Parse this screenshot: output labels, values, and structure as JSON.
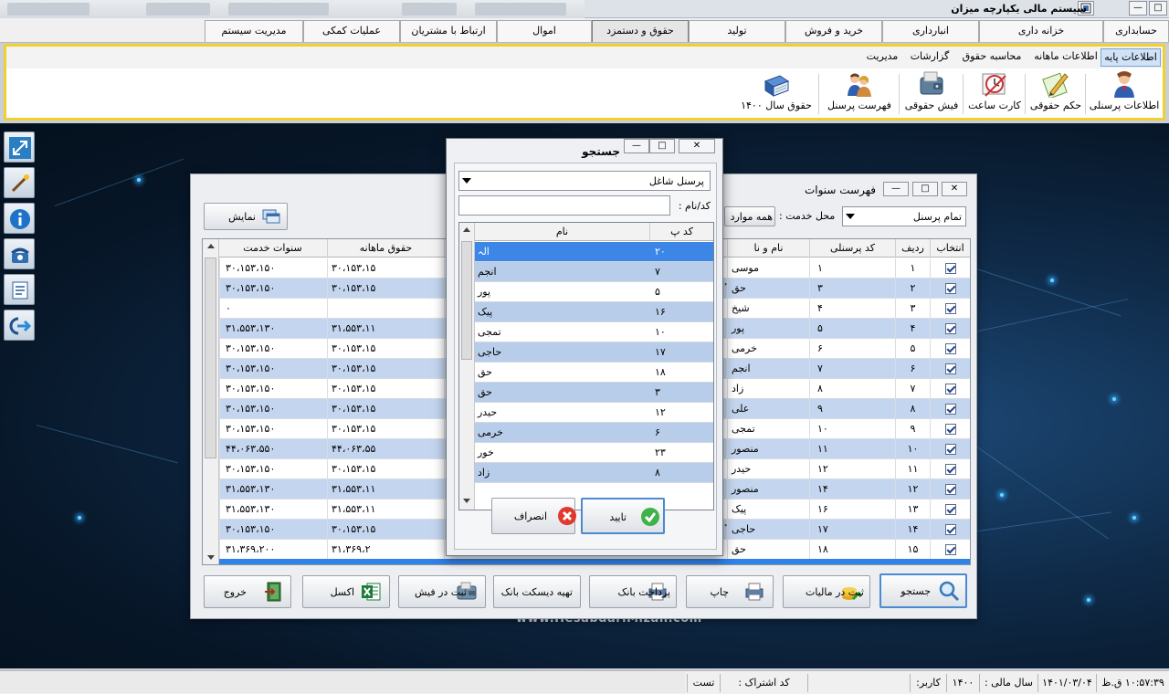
{
  "app": {
    "title": "سیستم مالی یکپارچه میزان",
    "window_buttons": [
      "□",
      "—"
    ]
  },
  "menu": {
    "tabs": [
      "حسابداری",
      "خزانه داری",
      "انبارداری",
      "خرید و فروش",
      "تولید",
      "حقوق و دستمزد",
      "اموال",
      "ارتباط با مشتریان",
      "عملیات کمکی",
      "مدیریت سیستم"
    ],
    "active_index": 5
  },
  "ribbon": {
    "tabs": [
      "اطلاعات پایه",
      "اطلاعات ماهانه",
      "محاسبه حقوق",
      "گزارشات",
      "مدیریت"
    ],
    "active_index": 0,
    "buttons": [
      {
        "label": "اطلاعات پرسنلی",
        "icon": "personnel-icon"
      },
      {
        "label": "حکم حقوقی",
        "icon": "decree-icon"
      },
      {
        "label": "کارت ساعت",
        "icon": "timecard-icon"
      },
      {
        "label": "فیش حقوقی",
        "icon": "payslip-icon"
      },
      {
        "label": "فهرست پرسنل",
        "icon": "staff-list-icon"
      },
      {
        "label": "حقوق سال ۱۴۰۰",
        "icon": "salary-year-icon"
      }
    ]
  },
  "side_toolbar": [
    "resize-icon",
    "magic-wand-icon",
    "info-icon",
    "phone-icon",
    "notes-icon",
    "exit-icon"
  ],
  "watermark": "www.HesabdariMizan.com",
  "main_window": {
    "title": "فهرست سنوات",
    "filters": {
      "personnel_select": "تمام پرسنل",
      "location_label": "محل خدمت :",
      "location_value": "همه موارد",
      "show_button": "نمایش"
    },
    "columns": [
      "انتخاب",
      "ردیف",
      "کد پرسنلی",
      "نام و نا",
      "",
      "حقوق ماهانه",
      "سنوات خدمت"
    ],
    "rows": [
      {
        "row": "۱",
        "code": "۱",
        "name": "موسی",
        "mark": "",
        "salary": "۳۰،۱۵۳،۱۵",
        "service": "۳۰،۱۵۳،۱۵۰"
      },
      {
        "row": "۲",
        "code": "۳",
        "name": "حق",
        "mark": "ٔ",
        "salary": "۳۰،۱۵۳،۱۵",
        "service": "۳۰،۱۵۳،۱۵۰"
      },
      {
        "row": "۳",
        "code": "۴",
        "name": "شیخ",
        "mark": "",
        "salary": "",
        "service": "۰"
      },
      {
        "row": "۴",
        "code": "۵",
        "name": "پور",
        "mark": "",
        "salary": "۳۱،۵۵۳،۱۱",
        "service": "۳۱،۵۵۳،۱۳۰"
      },
      {
        "row": "۵",
        "code": "۶",
        "name": "خرمی",
        "mark": "",
        "salary": "۳۰،۱۵۳،۱۵",
        "service": "۳۰،۱۵۳،۱۵۰"
      },
      {
        "row": "۶",
        "code": "۷",
        "name": "انجم",
        "mark": "",
        "salary": "۳۰،۱۵۳،۱۵",
        "service": "۳۰،۱۵۳،۱۵۰"
      },
      {
        "row": "۷",
        "code": "۸",
        "name": "زاد",
        "mark": "",
        "salary": "۳۰،۱۵۳،۱۵",
        "service": "۳۰،۱۵۳،۱۵۰"
      },
      {
        "row": "۸",
        "code": "۹",
        "name": "علی",
        "mark": "",
        "salary": "۳۰،۱۵۳،۱۵",
        "service": "۳۰،۱۵۳،۱۵۰"
      },
      {
        "row": "۹",
        "code": "۱۰",
        "name": "تمجی",
        "mark": "",
        "salary": "۳۰،۱۵۳،۱۵",
        "service": "۳۰،۱۵۳،۱۵۰"
      },
      {
        "row": "۱۰",
        "code": "۱۱",
        "name": "منصور",
        "mark": "",
        "salary": "۴۴،۰۶۳،۵۵",
        "service": "۴۴،۰۶۳،۵۵۰"
      },
      {
        "row": "۱۱",
        "code": "۱۲",
        "name": "حیدر",
        "mark": "",
        "salary": "۳۰،۱۵۳،۱۵",
        "service": "۳۰،۱۵۳،۱۵۰"
      },
      {
        "row": "۱۲",
        "code": "۱۴",
        "name": "منصور",
        "mark": "",
        "salary": "۳۱،۵۵۳،۱۱",
        "service": "۳۱،۵۵۳،۱۳۰"
      },
      {
        "row": "۱۳",
        "code": "۱۶",
        "name": "پیک",
        "mark": "",
        "salary": "۳۱،۵۵۳،۱۱",
        "service": "۳۱،۵۵۳،۱۳۰"
      },
      {
        "row": "۱۴",
        "code": "۱۷",
        "name": "حاجی",
        "mark": "ٔ",
        "salary": "۳۰،۱۵۳،۱۵",
        "service": "۳۰،۱۵۳،۱۵۰"
      },
      {
        "row": "۱۵",
        "code": "۱۸",
        "name": "حق",
        "mark": "",
        "salary": "۳۱،۳۶۹،۲",
        "service": "۳۱،۳۶۹،۲۰۰"
      }
    ],
    "bottom_buttons": [
      {
        "label": "جستجو",
        "icon": "search-icon"
      },
      {
        "label": "ثبت در مالیات",
        "icon": "tax-icon"
      },
      {
        "label": "چاپ",
        "icon": "print-icon"
      },
      {
        "label": "پرداخت بانک",
        "icon": "bank-pay-icon"
      },
      {
        "label": "تهیه دیسکت بانک",
        "icon": ""
      },
      {
        "label": "ثبت در فیش",
        "icon": "wallet-icon"
      },
      {
        "label": "اکسل",
        "icon": "excel-icon"
      },
      {
        "label": "خروج",
        "icon": "exit-door-icon"
      }
    ]
  },
  "dialog": {
    "title": "جستجو",
    "type_select": "پرسنل شاغل",
    "search_label": "کد/نام :",
    "search_value": "",
    "columns": [
      "کد پ",
      "نام"
    ],
    "rows": [
      {
        "code": "۲۰",
        "name": "الہ"
      },
      {
        "code": "۷",
        "name": "انجم"
      },
      {
        "code": "۵",
        "name": "پور"
      },
      {
        "code": "۱۶",
        "name": "پیک"
      },
      {
        "code": "۱۰",
        "name": "تمجی"
      },
      {
        "code": "۱۷",
        "name": "حاجی"
      },
      {
        "code": "۱۸",
        "name": "حق"
      },
      {
        "code": "۳",
        "name": "حق"
      },
      {
        "code": "۱۲",
        "name": "حیدر"
      },
      {
        "code": "۶",
        "name": "خرمی"
      },
      {
        "code": "۲۳",
        "name": "خور"
      },
      {
        "code": "۸",
        "name": "زاد"
      }
    ],
    "selected_index": 0,
    "confirm": "تایید",
    "cancel": "انصراف"
  },
  "status": {
    "time": "۱۰:۵۷:۳۹ ق.ظ",
    "date": "۱۴۰۱/۰۳/۰۴",
    "fiscal_year_label": "سال مالی :",
    "fiscal_year": "۱۴۰۰",
    "user_label": "کاربر:",
    "user": "",
    "subscription_label": "کد اشتراک :",
    "subscription": "تست"
  },
  "colors": {
    "ribbon_border": "#f0d030",
    "row_alt": "#c4d6ef",
    "selection": "#3b86e6",
    "desktop": "#0f2a48"
  }
}
